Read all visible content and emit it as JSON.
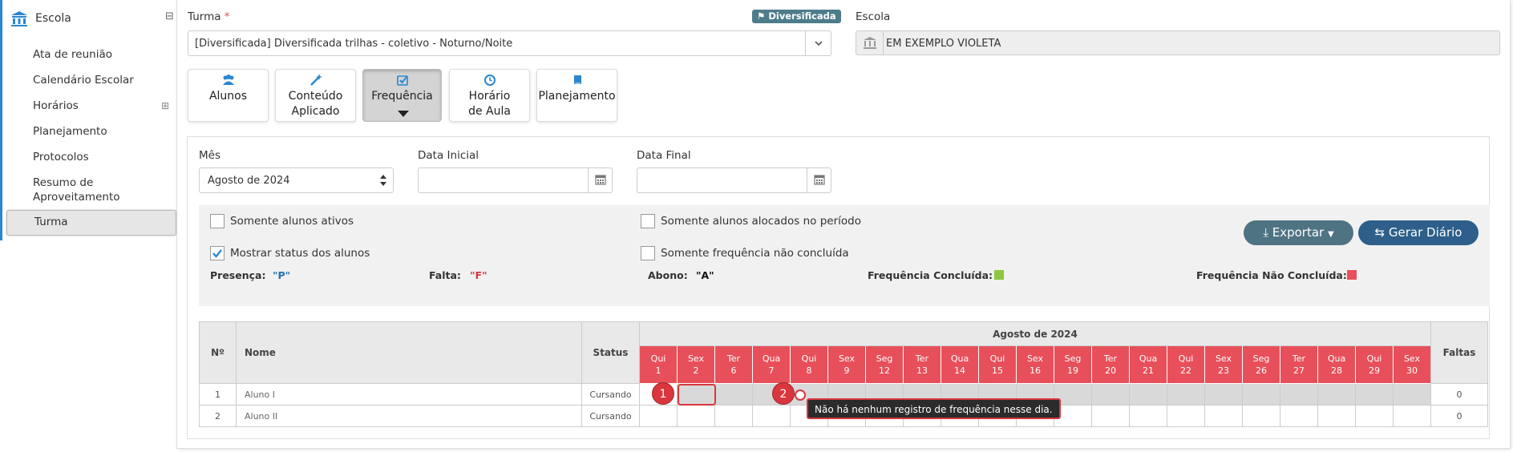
{
  "sidebar": {
    "section_title": "Escola",
    "collapse_symbol": "⊟",
    "expand_symbol": "⊞",
    "items": [
      {
        "label": "Ata de reunião"
      },
      {
        "label": "Calendário Escolar"
      },
      {
        "label": "Horários"
      },
      {
        "label": "Planejamento"
      },
      {
        "label": "Protocolos"
      },
      {
        "label": "Resumo de Aproveitamento"
      },
      {
        "label": "Turma"
      }
    ]
  },
  "form": {
    "turma_label": "Turma",
    "required_mark": "*",
    "badge": "Diversificada",
    "turma_value": "[Diversificada]  Diversificada trilhas - coletivo - Noturno/Noite",
    "escola_label": "Escola",
    "escola_value": "EM EXEMPLO VIOLETA"
  },
  "tabs": [
    {
      "label": "Alunos",
      "icon": "users-icon"
    },
    {
      "label": "Conteúdo Aplicado",
      "icon": "magic-wand-icon"
    },
    {
      "label": "Frequência",
      "icon": "check-square-icon",
      "active": true
    },
    {
      "label": "Horário de Aula",
      "icon": "clock-icon"
    },
    {
      "label": "Planejamento",
      "icon": "book-icon"
    }
  ],
  "filters": {
    "mes_label": "Mês",
    "mes_value": "Agosto de 2024",
    "data_inicial_label": "Data Inicial",
    "data_inicial_value": "",
    "data_final_label": "Data Final",
    "data_final_value": ""
  },
  "options": {
    "somente_ativos": {
      "label": "Somente alunos ativos",
      "checked": false
    },
    "mostrar_status": {
      "label": "Mostrar status dos alunos",
      "checked": true
    },
    "somente_alocados": {
      "label": "Somente alunos alocados no período",
      "checked": false
    },
    "somente_nao_concluida": {
      "label": "Somente frequência não concluída",
      "checked": false
    }
  },
  "buttons": {
    "exportar": "Exportar",
    "gerar_diario": "Gerar Diário"
  },
  "legend": {
    "presenca_label": "Presença:",
    "presenca_code": "\"P\"",
    "falta_label": "Falta:",
    "falta_code": "\"F\"",
    "abono_label": "Abono:",
    "abono_code": "\"A\"",
    "concluida_label": "Frequência Concluída:",
    "nao_concluida_label": "Frequência Não Concluída:",
    "concluida_color": "#8cc63f",
    "nao_concluida_color": "#e7505a"
  },
  "table": {
    "col_num": "Nº",
    "col_name": "Nome",
    "col_status": "Status",
    "month_header": "Agosto de 2024",
    "col_faltas": "Faltas",
    "days": [
      {
        "wd": "Qui",
        "d": "1"
      },
      {
        "wd": "Sex",
        "d": "2"
      },
      {
        "wd": "Ter",
        "d": "6"
      },
      {
        "wd": "Qua",
        "d": "7"
      },
      {
        "wd": "Qui",
        "d": "8"
      },
      {
        "wd": "Sex",
        "d": "9"
      },
      {
        "wd": "Seg",
        "d": "12"
      },
      {
        "wd": "Ter",
        "d": "13"
      },
      {
        "wd": "Qua",
        "d": "14"
      },
      {
        "wd": "Qui",
        "d": "15"
      },
      {
        "wd": "Sex",
        "d": "16"
      },
      {
        "wd": "Seg",
        "d": "19"
      },
      {
        "wd": "Ter",
        "d": "20"
      },
      {
        "wd": "Qua",
        "d": "21"
      },
      {
        "wd": "Qui",
        "d": "22"
      },
      {
        "wd": "Sex",
        "d": "23"
      },
      {
        "wd": "Seg",
        "d": "26"
      },
      {
        "wd": "Ter",
        "d": "27"
      },
      {
        "wd": "Qua",
        "d": "28"
      },
      {
        "wd": "Qui",
        "d": "29"
      },
      {
        "wd": "Sex",
        "d": "30"
      }
    ],
    "rows": [
      {
        "num": "1",
        "name": "Aluno I",
        "status": "Cursando",
        "faltas": "0"
      },
      {
        "num": "2",
        "name": "Aluno II",
        "status": "Cursando",
        "faltas": "0"
      }
    ]
  },
  "annotations": {
    "marker1": "1",
    "marker2": "2",
    "tooltip": "Não há nenhum registro de frequência nesse dia."
  },
  "colors": {
    "accent": "#2a87d0",
    "button_dark": "#4e7383",
    "button_blue": "#2d5f8a",
    "day_header": "#e7505a"
  }
}
